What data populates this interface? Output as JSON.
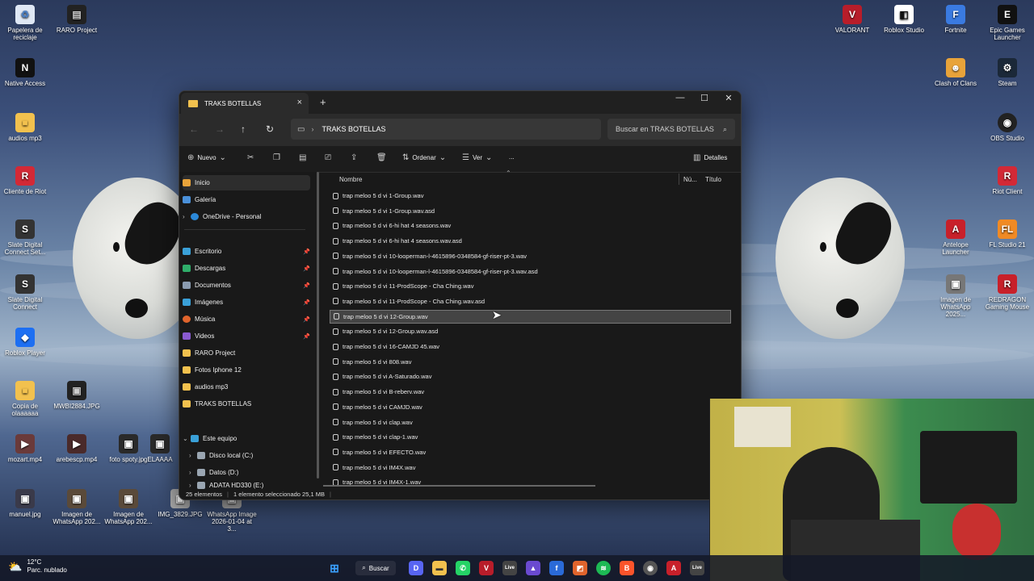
{
  "desktop": {
    "icons_left": [
      {
        "label": "Papelera de reciclaje",
        "icon": "recycle-bin-icon"
      },
      {
        "label": "RARO Project",
        "icon": "project-icon"
      },
      {
        "label": "Native Access",
        "icon": "native-access-icon"
      },
      {
        "label": "audios mp3",
        "icon": "folder-icon"
      },
      {
        "label": "Cliente de Riot",
        "icon": "riot-icon"
      },
      {
        "label": "Slate Digital Connect Set...",
        "icon": "slate-icon"
      },
      {
        "label": "Slate Digital Connect",
        "icon": "slate-icon"
      },
      {
        "label": "Roblox Player",
        "icon": "roblox-icon"
      },
      {
        "label": "Copia de olaaaaaa",
        "icon": "folder-icon"
      },
      {
        "label": "MWBI2884.JPG",
        "icon": "image-icon"
      },
      {
        "label": "mozart.mp4",
        "icon": "video-icon"
      },
      {
        "label": "arebescp.mp4",
        "icon": "video-icon"
      },
      {
        "label": "foto spoty.jpg",
        "icon": "image-icon"
      },
      {
        "label": "ELAAAA",
        "icon": "image-icon"
      },
      {
        "label": "manuel.jpg",
        "icon": "image-icon"
      },
      {
        "label": "Imagen de WhatsApp 202...",
        "icon": "image-icon"
      },
      {
        "label": "Imagen de WhatsApp 202...",
        "icon": "image-icon"
      },
      {
        "label": "IMG_3829.JPG",
        "icon": "image-icon"
      },
      {
        "label": "WhatsApp Image 2026-01-04 at 3...",
        "icon": "image-icon"
      }
    ],
    "icons_right": [
      {
        "label": "VALORANT",
        "icon": "valorant-icon"
      },
      {
        "label": "Roblox Studio",
        "icon": "roblox-studio-icon"
      },
      {
        "label": "Fortnite",
        "icon": "fortnite-icon"
      },
      {
        "label": "Epic Games Launcher",
        "icon": "epic-icon"
      },
      {
        "label": "Clash of Clans",
        "icon": "clash-icon"
      },
      {
        "label": "Steam",
        "icon": "steam-icon"
      },
      {
        "label": "OBS Studio",
        "icon": "obs-icon"
      },
      {
        "label": "Riot Client",
        "icon": "riot-icon"
      },
      {
        "label": "Antelope Launcher",
        "icon": "antelope-icon"
      },
      {
        "label": "FL Studio 21",
        "icon": "fl-studio-icon"
      },
      {
        "label": "Imagen de WhatsApp 2025...",
        "icon": "image-icon"
      },
      {
        "label": "REDRAGON Gaming Mouse",
        "icon": "redragon-icon"
      }
    ]
  },
  "explorer": {
    "tab_title": "TRAKS BOTELLAS",
    "address": "TRAKS BOTELLAS",
    "search_placeholder": "Buscar en TRAKS BOTELLAS",
    "toolbar": {
      "new_label": "Nuevo",
      "sort_label": "Ordenar",
      "view_label": "Ver",
      "more_label": "...",
      "details_label": "Detalles"
    },
    "nav": {
      "home": "Inicio",
      "gallery": "Galería",
      "onedrive": "OneDrive - Personal",
      "pinned": [
        "Escritorio",
        "Descargas",
        "Documentos",
        "Imágenes",
        "Música",
        "Videos"
      ],
      "folders": [
        "RARO Project",
        "Fotos Iphone 12",
        "audios mp3",
        "TRAKS BOTELLAS"
      ],
      "this_pc": "Este equipo",
      "drives": [
        "Disco local (C:)",
        "Datos (D:)",
        "ADATA HD330 (E:)"
      ]
    },
    "columns": {
      "name": "Nombre",
      "number": "Nú...",
      "title": "Título"
    },
    "files": [
      "trap meloo 5 d vi 1-Group.wav",
      "trap meloo 5 d vi 1-Group.wav.asd",
      "trap meloo 5 d vi 6-hi hat 4 seasons.wav",
      "trap meloo 5 d vi 6-hi hat 4 seasons.wav.asd",
      "trap meloo 5 d vi 10-looperman-l-4615896-0348584-gf-riser-pt-3.wav",
      "trap meloo 5 d vi 10-looperman-l-4615896-0348584-gf-riser-pt-3.wav.asd",
      "trap meloo 5 d vi 11-ProdScope - Cha Ching.wav",
      "trap meloo 5 d vi 11-ProdScope - Cha Ching.wav.asd",
      "trap meloo 5 d vi 12-Group.wav",
      "trap meloo 5 d vi 12-Group.wav.asd",
      "trap meloo 5 d vi 16-CAMJD 45.wav",
      "trap meloo 5 d vi 808.wav",
      "trap meloo 5 d vi A-Saturado.wav",
      "trap meloo 5 d vi B-reberv.wav",
      "trap meloo 5 d vi CAMJD.wav",
      "trap meloo 5 d vi clap.wav",
      "trap meloo 5 d vi clap-1.wav",
      "trap meloo 5 d vi EFECTO.wav",
      "trap meloo 5 d vi IM4X.wav",
      "trap meloo 5 d vi IM4X-1.wav"
    ],
    "selected_index": 8,
    "status": {
      "count": "25 elementos",
      "selection": "1 elemento seleccionado  25,1 MB"
    }
  },
  "taskbar": {
    "weather_temp": "12°C",
    "weather_desc": "Parc. nublado",
    "search_label": "Buscar"
  }
}
